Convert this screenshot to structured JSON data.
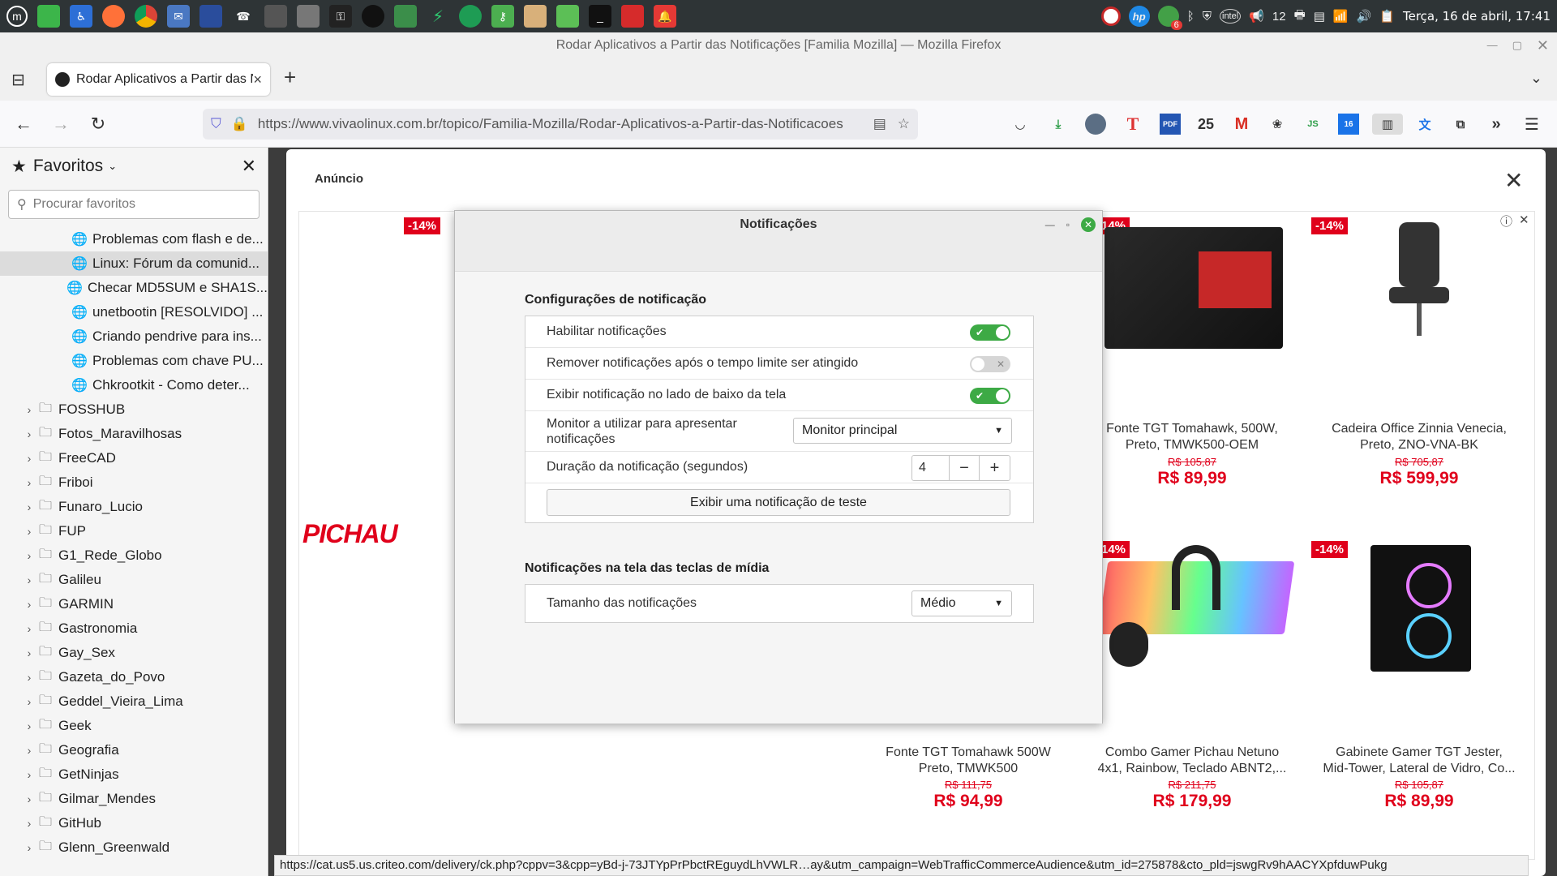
{
  "system_panel": {
    "clock": "Terça, 16 de abril, 17:41",
    "badge_count": "12",
    "notif_badge": "6",
    "colors": {
      "bg": "#2e3436"
    }
  },
  "window": {
    "title": "Rodar Aplicativos a Partir das Notificações [Familia Mozilla] — Mozilla Firefox"
  },
  "tab": {
    "title": "Rodar Aplicativos a Partir das Notificações",
    "new_tab": "+",
    "close": "×"
  },
  "navbar": {
    "url": "https://www.vivaolinux.com.br/topico/Familia-Mozilla/Rodar-Aplicativos-a-Partir-das-Notificacoes",
    "ext_badge": "25",
    "ext_pdf": "PDF",
    "ext_cal": "16"
  },
  "sidebar": {
    "title": "Favoritos",
    "search_placeholder": "Procurar favoritos",
    "bookmarks": [
      "Problemas com flash e de...",
      "Linux: Fórum da comunid...",
      "Checar MD5SUM e SHA1S...",
      "unetbootin [RESOLVIDO] ...",
      "Criando pendrive para ins...",
      "Problemas com chave PU...",
      "Chkrootkit - Como deter..."
    ],
    "folders": [
      "FOSSHUB",
      "Fotos_Maravilhosas",
      "FreeCAD",
      "Friboi",
      "Funaro_Lucio",
      "FUP",
      "G1_Rede_Globo",
      "Galileu",
      "GARMIN",
      "Gastronomia",
      "Gay_Sex",
      "Gazeta_do_Povo",
      "Geddel_Vieira_Lima",
      "Geek",
      "Geografia",
      "GetNinjas",
      "Gilmar_Mendes",
      "GitHub",
      "Glenn_Greenwald"
    ]
  },
  "ad": {
    "label": "Anúncio",
    "brand": "PICHAU",
    "discount": "-14%",
    "products": [
      {
        "name": "Fonte TGT Tomahawk, 500W, Preto, TMWK500-OEM",
        "old": "R$ 105,87",
        "price": "R$ 89,99"
      },
      {
        "name": "Cadeira Office Zinnia Venecia, Preto, ZNO-VNA-BK",
        "old": "R$ 705,87",
        "price": "R$ 599,99"
      },
      {
        "name": "Fonte TGT Tomahawk 500W Preto, TMWK500",
        "old": "R$ 111,75",
        "price": "R$ 94,99"
      },
      {
        "name": "Combo Gamer Pichau Netuno 4x1, Rainbow, Teclado ABNT2,...",
        "old": "R$ 211,75",
        "price": "R$ 179,99"
      },
      {
        "name": "Gabinete Gamer TGT Jester, Mid-Tower, Lateral de Vidro, Co...",
        "old": "R$ 105,87",
        "price": "R$ 89,99"
      }
    ]
  },
  "dialog": {
    "title": "Notificações",
    "section1_title": "Configurações de notificação",
    "enable_label": "Habilitar notificações",
    "enable_state": true,
    "remove_label": "Remover notificações após o tempo limite ser atingido",
    "remove_state": false,
    "bottom_label": "Exibir notificação no lado de baixo da tela",
    "bottom_state": true,
    "monitor_label": "Monitor a utilizar para apresentar notificações",
    "monitor_value": "Monitor principal",
    "duration_label": "Duração da notificação (segundos)",
    "duration_value": "4",
    "test_button": "Exibir uma notificação de teste",
    "section2_title": "Notificações na tela das teclas de mídia",
    "size_label": "Tamanho das notificações",
    "size_value": "Médio",
    "colors": {
      "accent": "#3daa45"
    }
  },
  "statusbar": {
    "url": "https://cat.us5.us.criteo.com/delivery/ck.php?cppv=3&cpp=yBd-j-73JTYpPrPbctREguydLhVWLR…ay&utm_campaign=WebTrafficCommerceAudience&utm_id=275878&cto_pld=jswgRv9hAACYXpfduwPukg"
  }
}
